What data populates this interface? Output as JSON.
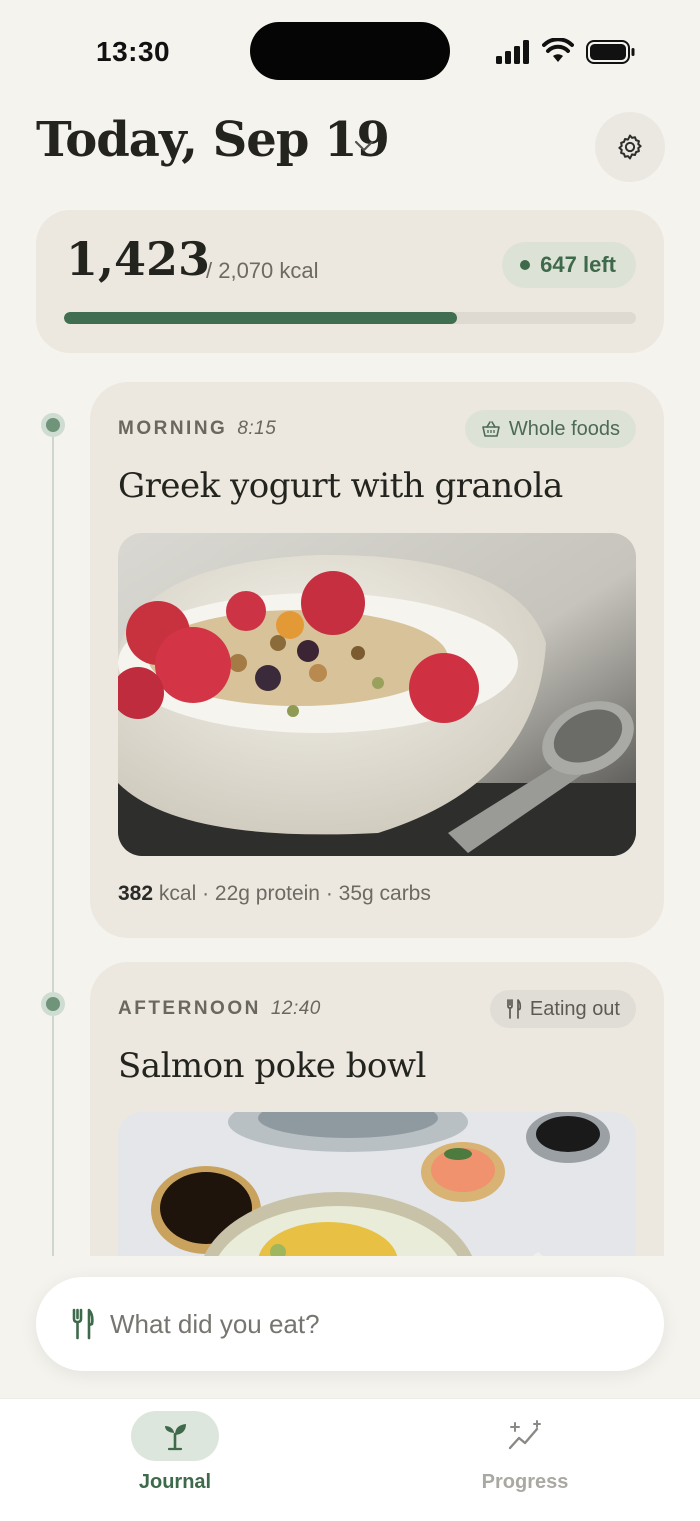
{
  "status_bar": {
    "time": "13:30"
  },
  "header": {
    "title": "Today, Sep 19"
  },
  "summary": {
    "consumed": "1,423",
    "goal": "/ 2,070 kcal",
    "remaining": "647 left",
    "progress_fraction": 0.687
  },
  "meals": [
    {
      "period": "MORNING",
      "time": "8:15",
      "tag": "Whole foods",
      "tag_icon": "basket-icon",
      "title": "Greek yogurt with granola",
      "kcal": "382",
      "macros": "kcal · 22g protein · 35g carbs"
    },
    {
      "period": "AFTERNOON",
      "time": "12:40",
      "tag": "Eating out",
      "tag_icon": "fork-knife-icon",
      "title": "Salmon poke bowl"
    }
  ],
  "composer": {
    "placeholder": "What did you eat?"
  },
  "tabs": [
    {
      "label": "Journal",
      "icon": "sprout-icon",
      "active": true
    },
    {
      "label": "Progress",
      "icon": "sparkle-chart-icon",
      "active": false
    }
  ],
  "colors": {
    "accent": "#416e50",
    "background": "#f5f3ee",
    "card": "#ece8e0"
  }
}
